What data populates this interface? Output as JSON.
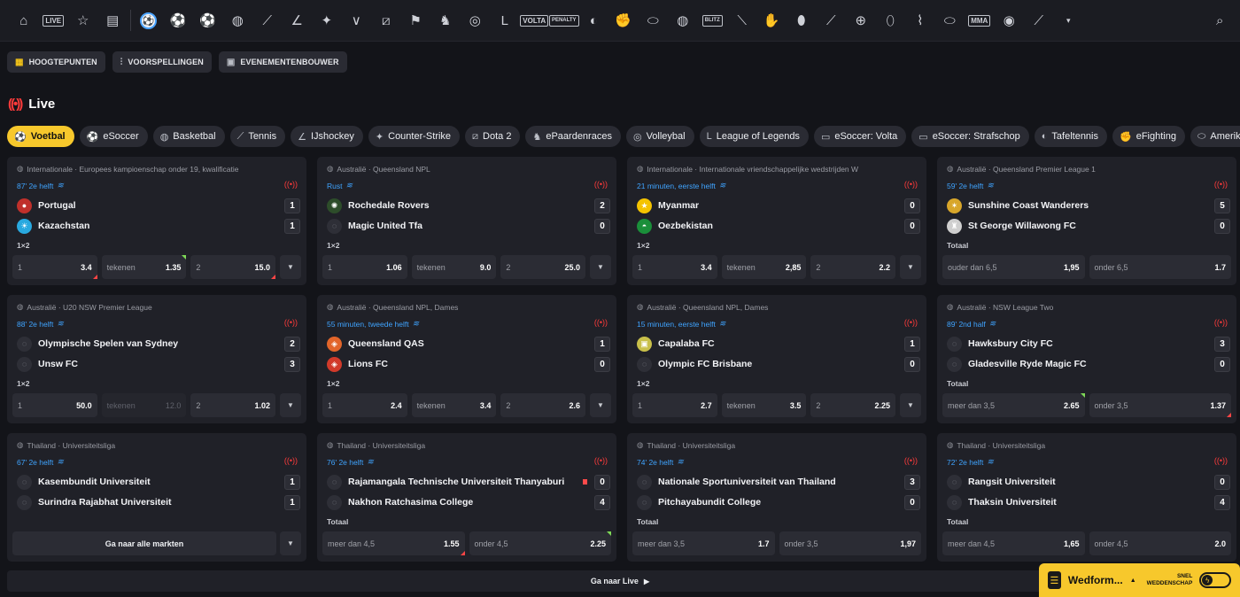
{
  "nav": {
    "icons": [
      "home-icon",
      "live-icon",
      "star-icon",
      "betslip-history-icon",
      "football-icon",
      "soccer-icon",
      "esoccer-icon",
      "basketball-icon",
      "tennis-icon",
      "hockey-icon",
      "counter-strike-icon",
      "valorant-icon",
      "dota2-icon",
      "racing-flag-icon",
      "horse-racing-icon",
      "volleyball-icon",
      "league-of-legends-icon",
      "esoccer-volta-icon",
      "esoccer-penalty-icon",
      "table-tennis-icon",
      "efighting-icon",
      "american-football-icon",
      "ebasketball-icon",
      "badminton-icon",
      "cricket-icon",
      "handball-icon",
      "rugby-icon",
      "etennis-icon",
      "darts-icon",
      "baseball-icon",
      "ehockey-icon",
      "american-football-2-icon",
      "mma-icon",
      "snooker-icon",
      "squash-icon",
      "chevron-down-icon"
    ],
    "live_label": "LIVE",
    "volta_label": "VOLTA",
    "penalty_label": "PENALTY",
    "blitz_label": "BLITZ",
    "mma_label": "MMA"
  },
  "subtabs": [
    {
      "label": "HOOGTEPUNTEN",
      "icon": "grid-icon"
    },
    {
      "label": "VOORSPELLINGEN",
      "icon": "chart-icon"
    },
    {
      "label": "EVENEMENTENBOUWER",
      "icon": "calendar-icon"
    }
  ],
  "live_title": "Live",
  "sports": [
    {
      "label": "Voetbal",
      "active": true
    },
    {
      "label": "eSoccer"
    },
    {
      "label": "Basketbal"
    },
    {
      "label": "Tennis"
    },
    {
      "label": "IJshockey"
    },
    {
      "label": "Counter-Strike"
    },
    {
      "label": "Dota 2"
    },
    {
      "label": "ePaardenraces"
    },
    {
      "label": "Volleybal"
    },
    {
      "label": "League of Legends"
    },
    {
      "label": "eSoccer: Volta"
    },
    {
      "label": "eSoccer: Strafschop"
    },
    {
      "label": "Tafeltennis"
    },
    {
      "label": "eFighting"
    },
    {
      "label": "Amerikaans"
    }
  ],
  "matches": [
    {
      "league": "Internationale · Europees kampioenschap onder 19, kwalificatie",
      "clock": "87' 2e helft",
      "home": "Portugal",
      "away": "Kazachstan",
      "home_score": "1",
      "away_score": "1",
      "market": "1×2",
      "odds": [
        {
          "l": "1",
          "v": "3.4"
        },
        {
          "l": "tekenen",
          "v": "1.35"
        },
        {
          "l": "2",
          "v": "15.0"
        }
      ]
    },
    {
      "league": "Australië · Queensland NPL",
      "clock": "Rust",
      "home": "Rochedale Rovers",
      "away": "Magic United Tfa",
      "home_score": "2",
      "away_score": "0",
      "market": "1×2",
      "odds": [
        {
          "l": "1",
          "v": "1.06"
        },
        {
          "l": "tekenen",
          "v": "9.0"
        },
        {
          "l": "2",
          "v": "25.0"
        }
      ]
    },
    {
      "league": "Internationale · Internationale vriendschappelijke wedstrijden W",
      "clock": "21 minuten, eerste helft",
      "home": "Myanmar",
      "away": "Oezbekistan",
      "home_score": "0",
      "away_score": "0",
      "market": "1×2",
      "odds": [
        {
          "l": "1",
          "v": "3.4"
        },
        {
          "l": "tekenen",
          "v": "2,85"
        },
        {
          "l": "2",
          "v": "2.2"
        }
      ]
    },
    {
      "league": "Australië · Queensland Premier League 1",
      "clock": "59' 2e helft",
      "home": "Sunshine Coast Wanderers",
      "away": "St George Willawong FC",
      "home_score": "5",
      "away_score": "0",
      "market": "Totaal",
      "odds": [
        {
          "l": "ouder dan 6,5",
          "v": "1,95"
        },
        {
          "l": "onder 6,5",
          "v": "1.7"
        }
      ]
    },
    {
      "league": "Australië · U20 NSW Premier League",
      "clock": "88' 2e helft",
      "home": "Olympische Spelen van Sydney",
      "away": "Unsw FC",
      "home_score": "2",
      "away_score": "3",
      "market": "1×2",
      "odds": [
        {
          "l": "1",
          "v": "50.0"
        },
        {
          "l": "tekenen",
          "v": "12.0"
        },
        {
          "l": "2",
          "v": "1.02"
        }
      ]
    },
    {
      "league": "Australië · Queensland NPL, Dames",
      "clock": "55 minuten, tweede helft",
      "home": "Queensland QAS",
      "away": "Lions FC",
      "home_score": "1",
      "away_score": "0",
      "market": "1×2",
      "odds": [
        {
          "l": "1",
          "v": "2.4"
        },
        {
          "l": "tekenen",
          "v": "3.4"
        },
        {
          "l": "2",
          "v": "2.6"
        }
      ]
    },
    {
      "league": "Australië · Queensland NPL, Dames",
      "clock": "15 minuten, eerste helft",
      "home": "Capalaba FC",
      "away": "Olympic FC Brisbane",
      "home_score": "1",
      "away_score": "0",
      "market": "1×2",
      "odds": [
        {
          "l": "1",
          "v": "2.7"
        },
        {
          "l": "tekenen",
          "v": "3.5"
        },
        {
          "l": "2",
          "v": "2.25"
        }
      ]
    },
    {
      "league": "Australië · NSW League Two",
      "clock": "89' 2nd half",
      "home": "Hawksbury City FC",
      "away": "Gladesville Ryde Magic FC",
      "home_score": "3",
      "away_score": "0",
      "market": "Totaal",
      "odds": [
        {
          "l": "meer dan 3,5",
          "v": "2.65"
        },
        {
          "l": "onder 3,5",
          "v": "1.37"
        }
      ]
    },
    {
      "league": "Thailand · Universiteitsliga",
      "clock": "67' 2e helft",
      "home": "Kasembundit Universiteit",
      "away": "Surindra Rajabhat Universiteit",
      "home_score": "1",
      "away_score": "1",
      "market": "",
      "cta": "Ga naar alle markten"
    },
    {
      "league": "Thailand · Universiteitsliga",
      "clock": "76' 2e helft",
      "home": "Rajamangala Technische Universiteit Thanyaburi",
      "away": "Nakhon Ratchasima College",
      "home_score": "0",
      "away_score": "4",
      "market": "Totaal",
      "odds": [
        {
          "l": "meer dan 4,5",
          "v": "1.55"
        },
        {
          "l": "onder 4,5",
          "v": "2.25"
        }
      ]
    },
    {
      "league": "Thailand · Universiteitsliga",
      "clock": "74' 2e helft",
      "home": "Nationale Sportuniversiteit van Thailand",
      "away": "Pitchayabundit College",
      "home_score": "3",
      "away_score": "0",
      "market": "Totaal",
      "odds": [
        {
          "l": "meer dan 3,5",
          "v": "1.7"
        },
        {
          "l": "onder 3,5",
          "v": "1,97"
        }
      ]
    },
    {
      "league": "Thailand · Universiteitsliga",
      "clock": "72' 2e helft",
      "home": "Rangsit Universiteit",
      "away": "Thaksin Universiteit",
      "home_score": "0",
      "away_score": "4",
      "market": "Totaal",
      "odds": [
        {
          "l": "meer dan 4,5",
          "v": "1,65"
        },
        {
          "l": "onder 4,5",
          "v": "2.0"
        }
      ]
    }
  ],
  "go_live": "Ga naar Live",
  "betslip": {
    "label": "Wedform...",
    "quick_line1": "SNEL",
    "quick_line2": "WEDDENSCHAP"
  },
  "colors": {
    "accent": "#f7c82c",
    "live_red": "#ff3b3b",
    "clock_blue": "#3fa4ff",
    "bg": "#131419",
    "card": "#202128"
  }
}
